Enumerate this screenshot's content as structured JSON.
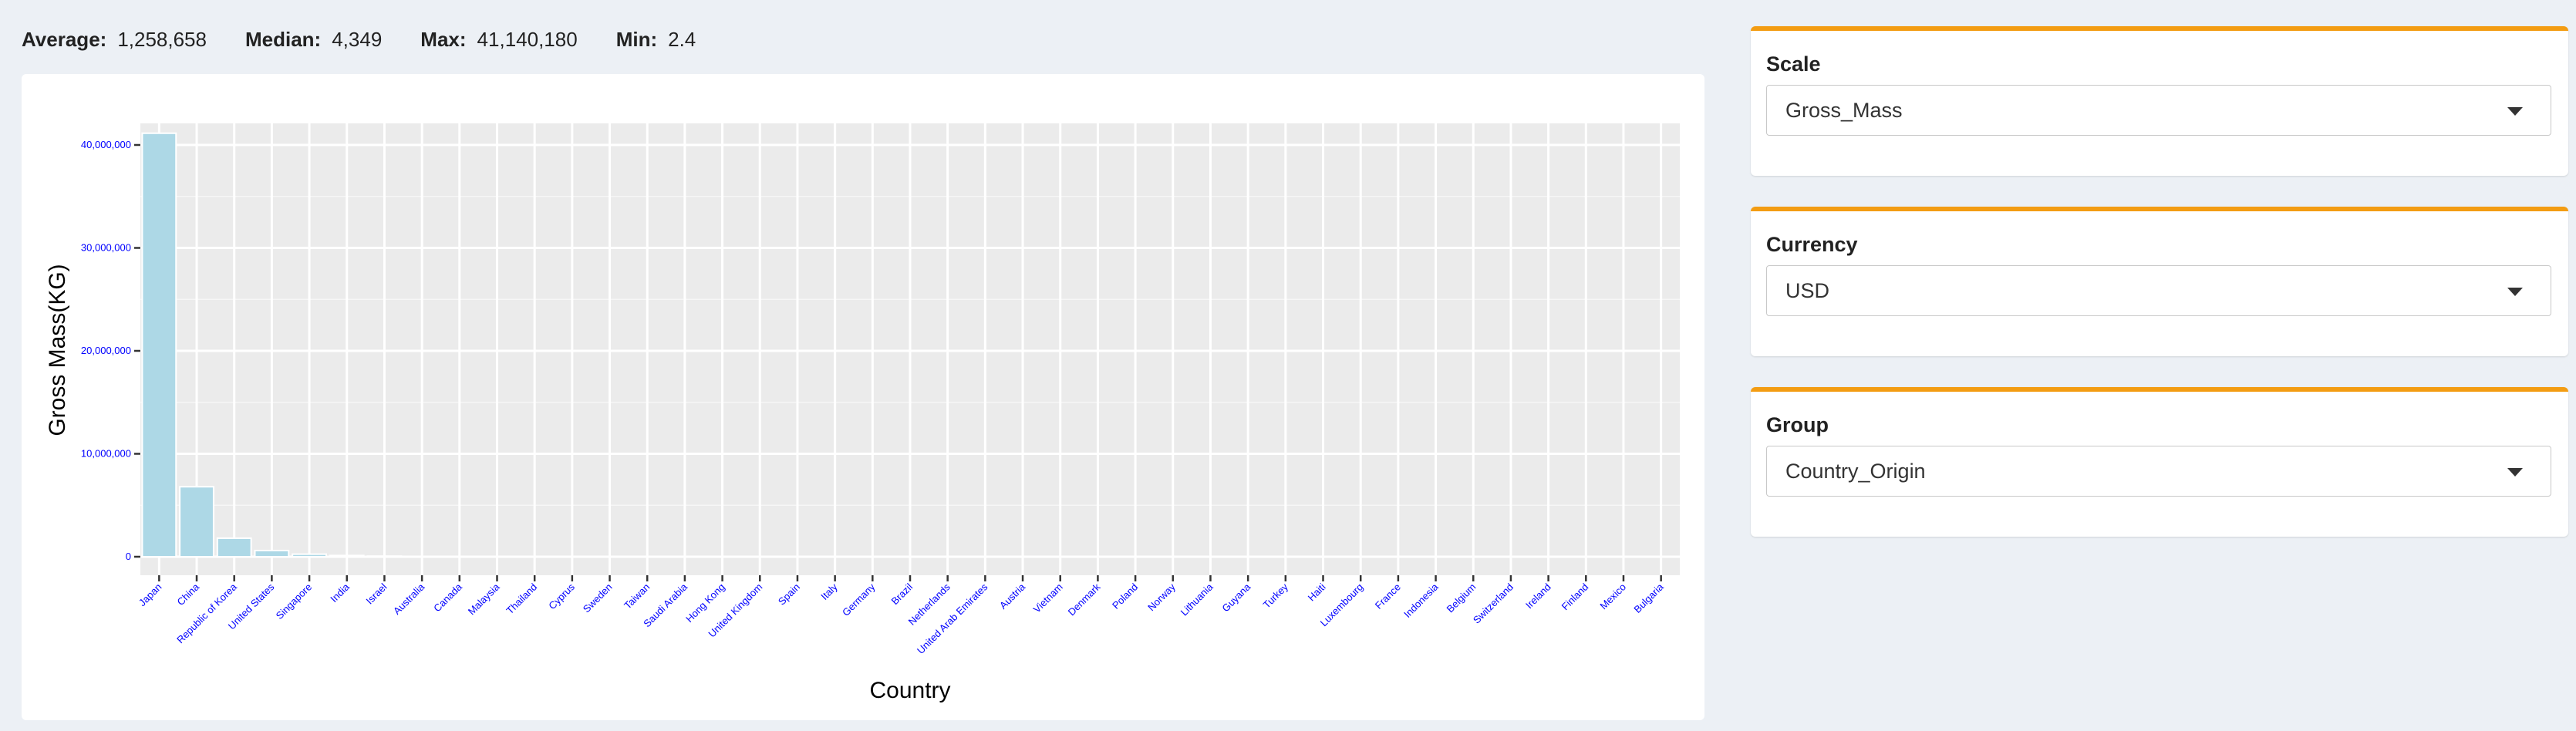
{
  "stats": {
    "average_label": "Average:",
    "average_value": "1,258,658",
    "median_label": "Median:",
    "median_value": "4,349",
    "max_label": "Max:",
    "max_value": "41,140,180",
    "min_label": "Min:",
    "min_value": "2.4"
  },
  "controls": {
    "scale": {
      "label": "Scale",
      "value": "Gross_Mass",
      "icon": "caret-down-icon"
    },
    "currency": {
      "label": "Currency",
      "value": "USD",
      "icon": "caret-down-icon"
    },
    "group": {
      "label": "Group",
      "value": "Country_Origin",
      "icon": "caret-down-icon"
    }
  },
  "chart_data": {
    "type": "bar",
    "xlabel": "Country",
    "ylabel": "Gross Mass(KG)",
    "ylim": [
      0,
      42000000
    ],
    "yticks": [
      0,
      10000000,
      20000000,
      30000000,
      40000000
    ],
    "ytick_labels": [
      "0",
      "10,000,000",
      "20,000,000",
      "30,000,000",
      "40,000,000"
    ],
    "grid": true,
    "bar_color": "#add8e6",
    "panel_color": "#ebebeb",
    "tick_label_color": "#0000ff",
    "categories": [
      "Japan",
      "China",
      "Republic of Korea",
      "United States",
      "Singapore",
      "India",
      "Israel",
      "Australia",
      "Canada",
      "Malaysia",
      "Thailand",
      "Cyprus",
      "Sweden",
      "Taiwan",
      "Saudi Arabia",
      "Hong Kong",
      "United Kingdom",
      "Spain",
      "Italy",
      "Germany",
      "Brazil",
      "Netherlands",
      "United Arab Emirates",
      "Austria",
      "Vietnam",
      "Denmark",
      "Poland",
      "Norway",
      "Lithuania",
      "Guyana",
      "Turkey",
      "Haiti",
      "Luxembourg",
      "France",
      "Indonesia",
      "Belgium",
      "Switzerland",
      "Ireland",
      "Finland",
      "Mexico",
      "Bulgaria"
    ],
    "values": [
      41140180,
      6800000,
      1800000,
      600000,
      250000,
      120000,
      60000,
      30000,
      15000,
      10000,
      8000,
      6000,
      5000,
      4349,
      3500,
      3000,
      2500,
      2000,
      1800,
      1500,
      1200,
      1000,
      900,
      800,
      700,
      600,
      500,
      400,
      300,
      250,
      200,
      150,
      120,
      100,
      80,
      60,
      40,
      20,
      10,
      5,
      2.4
    ]
  }
}
